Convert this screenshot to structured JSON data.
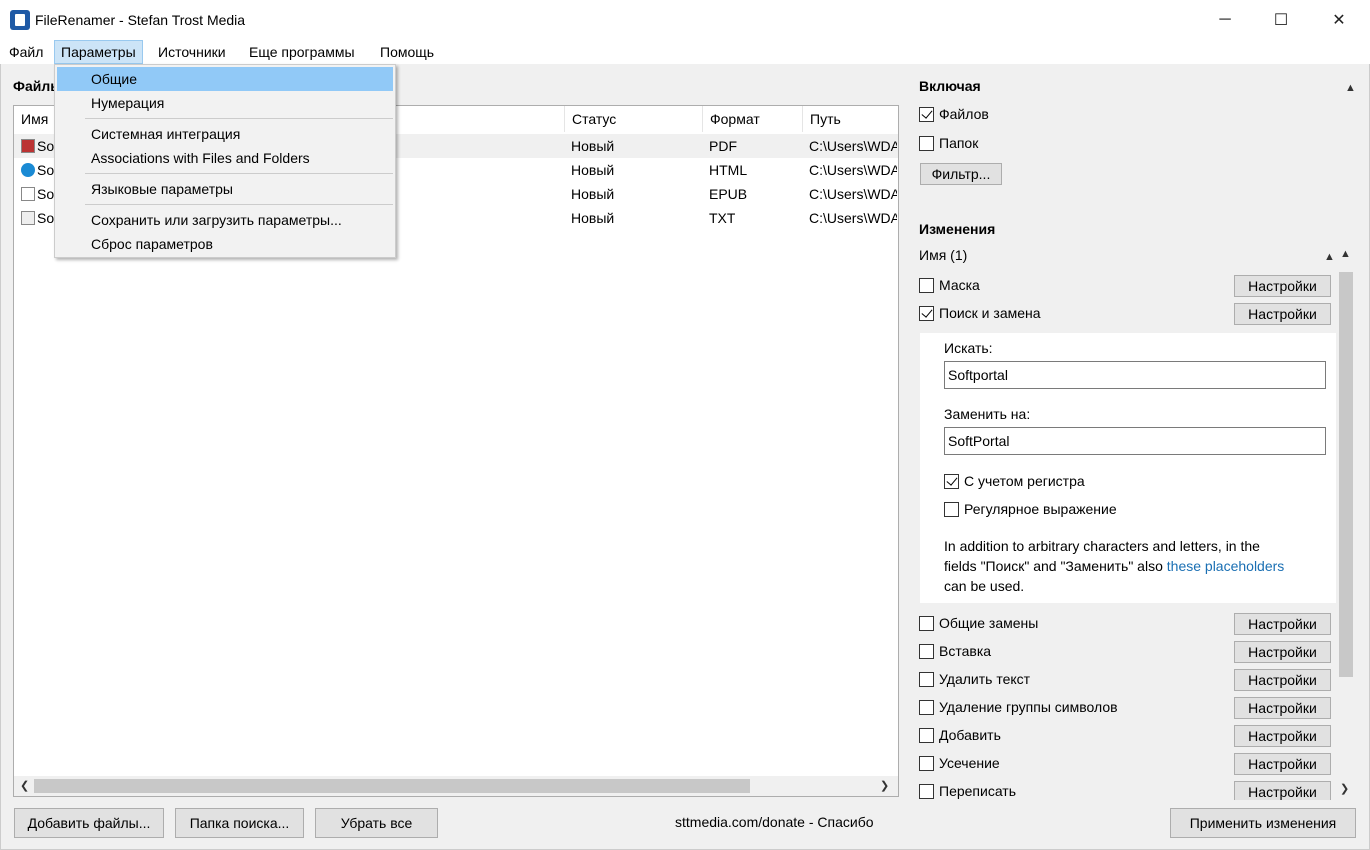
{
  "window": {
    "title": "FileRenamer - Stefan Trost Media",
    "minimize": "─",
    "maximize": "☐",
    "close": "✕"
  },
  "menubar": {
    "items": [
      "Файл",
      "Параметры",
      "Источники",
      "Еще программы",
      "Помощь"
    ]
  },
  "dropdown": {
    "items": [
      "Общие",
      "Нумерация",
      "Системная интеграция",
      "Associations with Files and Folders",
      "Языковые параметры",
      "Сохранить или загрузить параметры...",
      "Сброс параметров"
    ]
  },
  "files": {
    "title": "Файлы",
    "columns": [
      "Имя",
      "Статус",
      "Формат",
      "Путь"
    ],
    "rows": [
      {
        "name": "So",
        "status": "Новый",
        "format": "PDF",
        "path": "C:\\Users\\WDA",
        "icon": "pdf-icon"
      },
      {
        "name": "So",
        "status": "Новый",
        "format": "HTML",
        "path": "C:\\Users\\WDA",
        "icon": "edge-icon"
      },
      {
        "name": "So",
        "status": "Новый",
        "format": "EPUB",
        "path": "C:\\Users\\WDA",
        "icon": "file-icon"
      },
      {
        "name": "So",
        "status": "Новый",
        "format": "TXT",
        "path": "C:\\Users\\WDA",
        "icon": "text-file-icon"
      }
    ]
  },
  "bottom": {
    "add_files": "Добавить файлы...",
    "search_folder": "Папка поиска...",
    "remove_all": "Убрать все",
    "donate": "sttmedia.com/donate - Спасибо",
    "apply": "Применить изменения"
  },
  "include": {
    "title": "Включая",
    "files_label": "Файлов",
    "folders_label": "Папок",
    "filter_button": "Фильтр..."
  },
  "changes": {
    "title": "Изменения",
    "name_group": "Имя (1)",
    "settings_label": "Настройки",
    "mask": "Маска",
    "search_replace": "Поиск и замена",
    "find_label": "Искать:",
    "find_value": "Softportal",
    "replace_label": "Заменить на:",
    "replace_value": "SoftPortal",
    "case_sensitive": "С учетом регистра",
    "regex": "Регулярное выражение",
    "info_line1": "In addition to arbitrary characters and letters, in the",
    "info_line2a": "fields \"Поиск\" and \"Заменить\" also ",
    "info_link": "these placeholders",
    "info_line3": "can be used.",
    "items": [
      "Общие замены",
      "Вставка",
      "Удалить текст",
      "Удаление группы символов",
      "Добавить",
      "Усечение",
      "Переписать"
    ]
  },
  "colors": {
    "menu_active": "#cce4f7",
    "dropdown_hover": "#91c9f7",
    "link": "#1a6fb3"
  }
}
